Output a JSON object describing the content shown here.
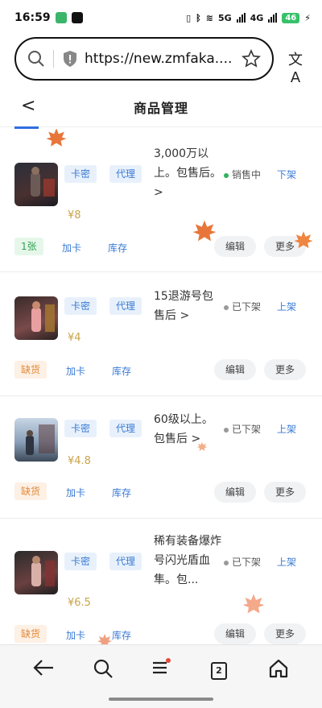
{
  "status_bar": {
    "time": "16:59",
    "network_5g": "5G",
    "network_4g": "4G",
    "battery": "46"
  },
  "browser": {
    "url": "https://new.zmfaka....",
    "translate_icon": "文A"
  },
  "header": {
    "back": "<",
    "title": "商品管理"
  },
  "products": [
    {
      "tags": [
        "卡密",
        "代理"
      ],
      "name": "3,000万以上。包售后。>",
      "status": "销售中",
      "status_active": true,
      "toggle": "下架",
      "price": "¥8",
      "stock": "1张",
      "stock_ok": true,
      "add_card": "加卡",
      "inventory": "库存",
      "edit": "编辑",
      "more": "更多"
    },
    {
      "tags": [
        "卡密",
        "代理"
      ],
      "name": "15退游号包售后 >",
      "status": "已下架",
      "status_active": false,
      "toggle": "上架",
      "price": "¥4",
      "stock": "缺货",
      "stock_ok": false,
      "add_card": "加卡",
      "inventory": "库存",
      "edit": "编辑",
      "more": "更多"
    },
    {
      "tags": [
        "卡密",
        "代理"
      ],
      "name": "60级以上。包售后 >",
      "status": "已下架",
      "status_active": false,
      "toggle": "上架",
      "price": "¥4.8",
      "stock": "缺货",
      "stock_ok": false,
      "add_card": "加卡",
      "inventory": "库存",
      "edit": "编辑",
      "more": "更多"
    },
    {
      "tags": [
        "卡密",
        "代理"
      ],
      "name": "稀有装备爆炸号闪光盾血隼。包...",
      "status": "已下架",
      "status_active": false,
      "toggle": "上架",
      "price": "¥6.5",
      "stock": "缺货",
      "stock_ok": false,
      "add_card": "加卡",
      "inventory": "库存",
      "edit": "编辑",
      "more": "更多"
    }
  ],
  "bottom_nav": {
    "tab_count": "2",
    "icons": [
      "back-arrow-icon",
      "search-icon",
      "menu-icon",
      "tabs-icon",
      "home-icon"
    ]
  },
  "colors": {
    "accent": "#3a7bd5",
    "active_status": "#2fb35a",
    "price": "#c9a44a",
    "out_of_stock": "#e28a38",
    "leaf": "#e8763a"
  }
}
